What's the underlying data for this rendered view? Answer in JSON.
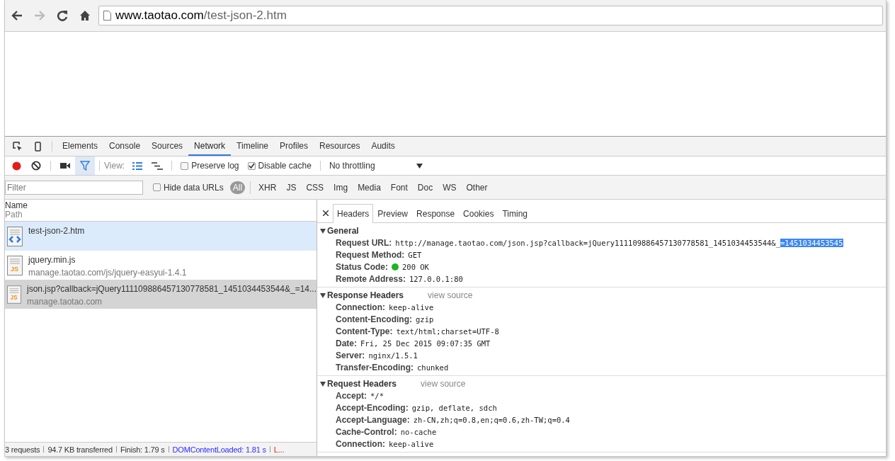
{
  "browser": {
    "back_disabled": false,
    "forward_disabled": true,
    "url_host": "www.taotao.com",
    "url_path": "/test-json-2.htm"
  },
  "devtools": {
    "tabs": [
      {
        "label": "Elements",
        "selected": false
      },
      {
        "label": "Console",
        "selected": false
      },
      {
        "label": "Sources",
        "selected": false
      },
      {
        "label": "Network",
        "selected": true
      },
      {
        "label": "Timeline",
        "selected": false
      },
      {
        "label": "Profiles",
        "selected": false
      },
      {
        "label": "Resources",
        "selected": false
      },
      {
        "label": "Audits",
        "selected": false
      }
    ],
    "toolbar": {
      "recording": true,
      "filter_on": true,
      "view_label": "View:",
      "preserve_log": {
        "label": "Preserve log",
        "checked": false
      },
      "disable_cache": {
        "label": "Disable cache",
        "checked": true
      },
      "throttling": "No throttling"
    },
    "filter_bar": {
      "placeholder": "Filter",
      "hide_data_urls": {
        "label": "Hide data URLs",
        "checked": false
      },
      "types": [
        {
          "label": "All",
          "selected": true
        },
        {
          "label": "XHR",
          "selected": false
        },
        {
          "label": "JS",
          "selected": false
        },
        {
          "label": "CSS",
          "selected": false
        },
        {
          "label": "Img",
          "selected": false
        },
        {
          "label": "Media",
          "selected": false
        },
        {
          "label": "Font",
          "selected": false
        },
        {
          "label": "Doc",
          "selected": false
        },
        {
          "label": "WS",
          "selected": false
        },
        {
          "label": "Other",
          "selected": false
        }
      ]
    },
    "request_list": {
      "columns": [
        "Name",
        "Path"
      ],
      "rows": [
        {
          "kind": "html",
          "name": "test-json-2.htm",
          "highlighted": true,
          "selected": false
        },
        {
          "kind": "js",
          "icon_text": "JS",
          "name": "jquery.min.js",
          "path": "manage.taotao.com/js/jquery-easyui-1.4.1",
          "highlighted": false,
          "selected": false
        },
        {
          "kind": "js",
          "icon_text": "JS",
          "name": "json.jsp?callback=jQuery111109886457130778581_1451034453544&_=14...",
          "path": "manage.taotao.com",
          "highlighted": false,
          "selected": true
        }
      ]
    },
    "status_bar": [
      {
        "kind": "plain",
        "text": "3 requests"
      },
      {
        "kind": "plain",
        "text": "94.7 KB transferred"
      },
      {
        "kind": "plain",
        "text": "Finish: 1.79 s"
      },
      {
        "kind": "dom",
        "text": "DOMContentLoaded: 1.81 s"
      },
      {
        "kind": "load",
        "text": "L..."
      }
    ],
    "details": {
      "tabs": [
        {
          "label": "Headers",
          "selected": true
        },
        {
          "label": "Preview",
          "selected": false
        },
        {
          "label": "Response",
          "selected": false
        },
        {
          "label": "Cookies",
          "selected": false
        },
        {
          "label": "Timing",
          "selected": false
        }
      ],
      "sections": [
        {
          "title": "General",
          "expanded": true,
          "headers": [
            {
              "name": "Request URL:",
              "value": "http://manage.taotao.com/json.jsp?callback=jQuery111109886457130778581_1451034453544&_",
              "selected_text": "=1451034453545"
            },
            {
              "name": "Request Method:",
              "value": "GET"
            },
            {
              "name": "Status Code:",
              "value": "200 OK",
              "success": true
            },
            {
              "name": "Remote Address:",
              "value": "127.0.0.1:80"
            }
          ]
        },
        {
          "title": "Response Headers",
          "expanded": true,
          "view_source": "view source",
          "headers": [
            {
              "name": "Connection:",
              "value": "keep-alive"
            },
            {
              "name": "Content-Encoding:",
              "value": "gzip"
            },
            {
              "name": "Content-Type:",
              "value": "text/html;charset=UTF-8"
            },
            {
              "name": "Date:",
              "value": "Fri, 25 Dec 2015 09:07:35 GMT"
            },
            {
              "name": "Server:",
              "value": "nginx/1.5.1"
            },
            {
              "name": "Transfer-Encoding:",
              "value": "chunked"
            }
          ]
        },
        {
          "title": "Request Headers",
          "expanded": true,
          "view_source": "view source",
          "headers": [
            {
              "name": "Accept:",
              "value": "*/*"
            },
            {
              "name": "Accept-Encoding:",
              "value": "gzip, deflate, sdch"
            },
            {
              "name": "Accept-Language:",
              "value": "zh-CN,zh;q=0.8,en;q=0.6,zh-TW;q=0.4"
            },
            {
              "name": "Cache-Control:",
              "value": "no-cache"
            },
            {
              "name": "Connection:",
              "value": "keep-alive"
            }
          ]
        }
      ]
    }
  }
}
